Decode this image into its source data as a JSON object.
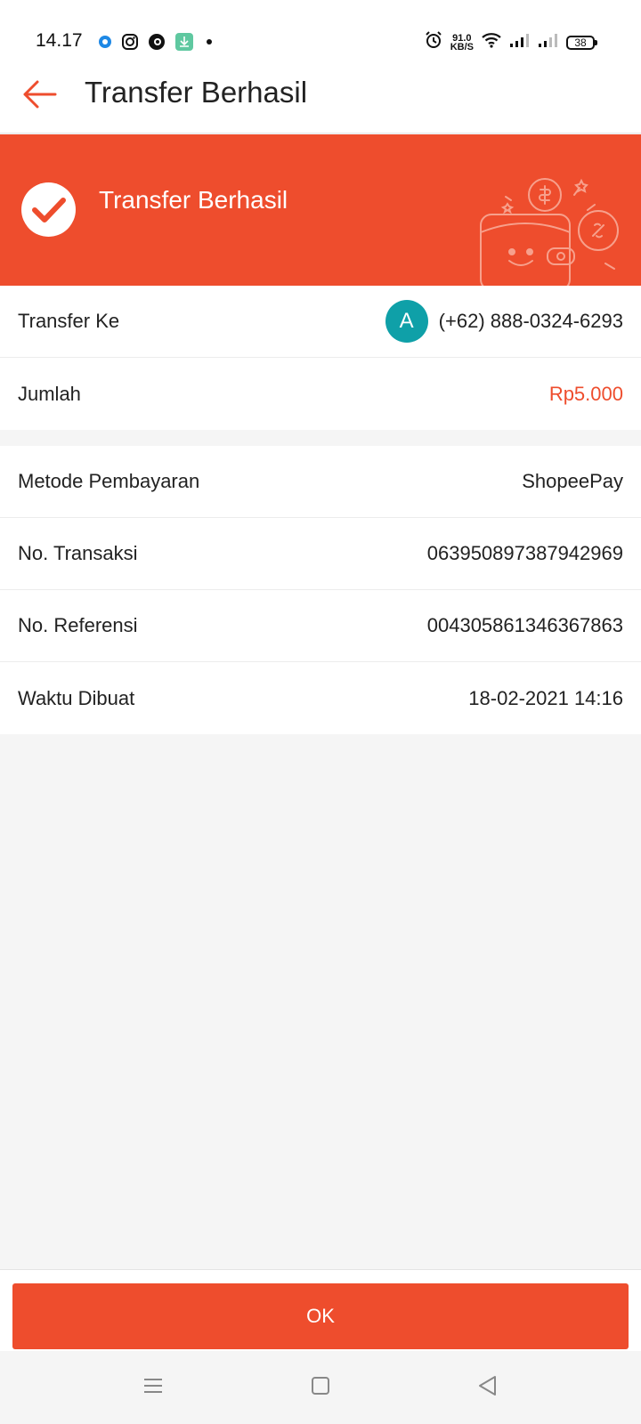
{
  "status_bar": {
    "time": "14.17",
    "speed_value": "91.0",
    "speed_unit": "KB/S",
    "battery": "38",
    "notification_icons": [
      "location-icon",
      "instagram-icon",
      "app-icon",
      "download-icon",
      "dot-icon"
    ],
    "system_icons": [
      "alarm-icon",
      "wifi-icon",
      "signal-icon",
      "signal-icon"
    ]
  },
  "app_bar": {
    "title": "Transfer Berhasil",
    "back_icon": "arrow-left-icon"
  },
  "banner": {
    "title": "Transfer Berhasil",
    "icon": "check-circle-icon"
  },
  "recipient": {
    "label": "Transfer Ke",
    "avatar_initial": "A",
    "phone": "(+62) 888-0324-6293"
  },
  "amount": {
    "label": "Jumlah",
    "value": "Rp5.000"
  },
  "details": [
    {
      "label": "Metode Pembayaran",
      "value": "ShopeePay"
    },
    {
      "label": "No. Transaksi",
      "value": "063950897387942969"
    },
    {
      "label": "No. Referensi",
      "value": "004305861346367863"
    },
    {
      "label": "Waktu Dibuat",
      "value": "18-02-2021 14:16"
    }
  ],
  "actions": {
    "ok_label": "OK"
  },
  "colors": {
    "brand": "#ee4d2d",
    "avatar": "#0fa0a8",
    "background": "#f5f5f5"
  },
  "nav_bar": {
    "icons": [
      "menu-icon",
      "home-icon",
      "back-icon"
    ]
  }
}
